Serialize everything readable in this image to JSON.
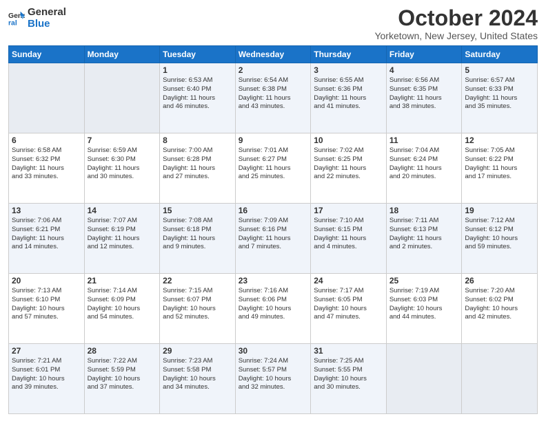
{
  "header": {
    "logo_line1": "General",
    "logo_line2": "Blue",
    "month_title": "October 2024",
    "location": "Yorketown, New Jersey, United States"
  },
  "days_of_week": [
    "Sunday",
    "Monday",
    "Tuesday",
    "Wednesday",
    "Thursday",
    "Friday",
    "Saturday"
  ],
  "weeks": [
    [
      {
        "day": "",
        "info": ""
      },
      {
        "day": "",
        "info": ""
      },
      {
        "day": "1",
        "info": "Sunrise: 6:53 AM\nSunset: 6:40 PM\nDaylight: 11 hours\nand 46 minutes."
      },
      {
        "day": "2",
        "info": "Sunrise: 6:54 AM\nSunset: 6:38 PM\nDaylight: 11 hours\nand 43 minutes."
      },
      {
        "day": "3",
        "info": "Sunrise: 6:55 AM\nSunset: 6:36 PM\nDaylight: 11 hours\nand 41 minutes."
      },
      {
        "day": "4",
        "info": "Sunrise: 6:56 AM\nSunset: 6:35 PM\nDaylight: 11 hours\nand 38 minutes."
      },
      {
        "day": "5",
        "info": "Sunrise: 6:57 AM\nSunset: 6:33 PM\nDaylight: 11 hours\nand 35 minutes."
      }
    ],
    [
      {
        "day": "6",
        "info": "Sunrise: 6:58 AM\nSunset: 6:32 PM\nDaylight: 11 hours\nand 33 minutes."
      },
      {
        "day": "7",
        "info": "Sunrise: 6:59 AM\nSunset: 6:30 PM\nDaylight: 11 hours\nand 30 minutes."
      },
      {
        "day": "8",
        "info": "Sunrise: 7:00 AM\nSunset: 6:28 PM\nDaylight: 11 hours\nand 27 minutes."
      },
      {
        "day": "9",
        "info": "Sunrise: 7:01 AM\nSunset: 6:27 PM\nDaylight: 11 hours\nand 25 minutes."
      },
      {
        "day": "10",
        "info": "Sunrise: 7:02 AM\nSunset: 6:25 PM\nDaylight: 11 hours\nand 22 minutes."
      },
      {
        "day": "11",
        "info": "Sunrise: 7:04 AM\nSunset: 6:24 PM\nDaylight: 11 hours\nand 20 minutes."
      },
      {
        "day": "12",
        "info": "Sunrise: 7:05 AM\nSunset: 6:22 PM\nDaylight: 11 hours\nand 17 minutes."
      }
    ],
    [
      {
        "day": "13",
        "info": "Sunrise: 7:06 AM\nSunset: 6:21 PM\nDaylight: 11 hours\nand 14 minutes."
      },
      {
        "day": "14",
        "info": "Sunrise: 7:07 AM\nSunset: 6:19 PM\nDaylight: 11 hours\nand 12 minutes."
      },
      {
        "day": "15",
        "info": "Sunrise: 7:08 AM\nSunset: 6:18 PM\nDaylight: 11 hours\nand 9 minutes."
      },
      {
        "day": "16",
        "info": "Sunrise: 7:09 AM\nSunset: 6:16 PM\nDaylight: 11 hours\nand 7 minutes."
      },
      {
        "day": "17",
        "info": "Sunrise: 7:10 AM\nSunset: 6:15 PM\nDaylight: 11 hours\nand 4 minutes."
      },
      {
        "day": "18",
        "info": "Sunrise: 7:11 AM\nSunset: 6:13 PM\nDaylight: 11 hours\nand 2 minutes."
      },
      {
        "day": "19",
        "info": "Sunrise: 7:12 AM\nSunset: 6:12 PM\nDaylight: 10 hours\nand 59 minutes."
      }
    ],
    [
      {
        "day": "20",
        "info": "Sunrise: 7:13 AM\nSunset: 6:10 PM\nDaylight: 10 hours\nand 57 minutes."
      },
      {
        "day": "21",
        "info": "Sunrise: 7:14 AM\nSunset: 6:09 PM\nDaylight: 10 hours\nand 54 minutes."
      },
      {
        "day": "22",
        "info": "Sunrise: 7:15 AM\nSunset: 6:07 PM\nDaylight: 10 hours\nand 52 minutes."
      },
      {
        "day": "23",
        "info": "Sunrise: 7:16 AM\nSunset: 6:06 PM\nDaylight: 10 hours\nand 49 minutes."
      },
      {
        "day": "24",
        "info": "Sunrise: 7:17 AM\nSunset: 6:05 PM\nDaylight: 10 hours\nand 47 minutes."
      },
      {
        "day": "25",
        "info": "Sunrise: 7:19 AM\nSunset: 6:03 PM\nDaylight: 10 hours\nand 44 minutes."
      },
      {
        "day": "26",
        "info": "Sunrise: 7:20 AM\nSunset: 6:02 PM\nDaylight: 10 hours\nand 42 minutes."
      }
    ],
    [
      {
        "day": "27",
        "info": "Sunrise: 7:21 AM\nSunset: 6:01 PM\nDaylight: 10 hours\nand 39 minutes."
      },
      {
        "day": "28",
        "info": "Sunrise: 7:22 AM\nSunset: 5:59 PM\nDaylight: 10 hours\nand 37 minutes."
      },
      {
        "day": "29",
        "info": "Sunrise: 7:23 AM\nSunset: 5:58 PM\nDaylight: 10 hours\nand 34 minutes."
      },
      {
        "day": "30",
        "info": "Sunrise: 7:24 AM\nSunset: 5:57 PM\nDaylight: 10 hours\nand 32 minutes."
      },
      {
        "day": "31",
        "info": "Sunrise: 7:25 AM\nSunset: 5:55 PM\nDaylight: 10 hours\nand 30 minutes."
      },
      {
        "day": "",
        "info": ""
      },
      {
        "day": "",
        "info": ""
      }
    ]
  ]
}
